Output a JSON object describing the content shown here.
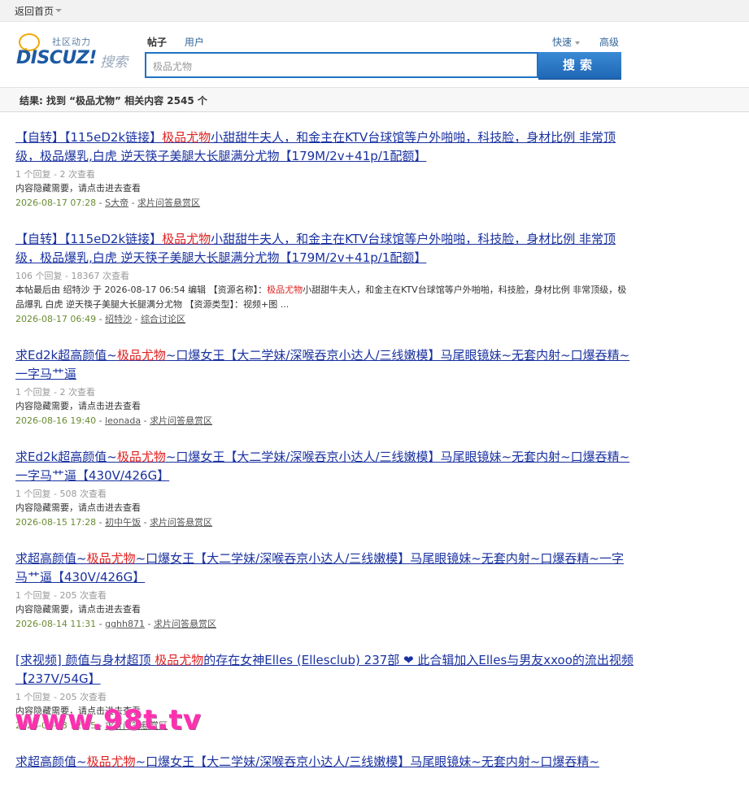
{
  "topbar": {
    "home_label": "返回首页"
  },
  "logo": {
    "slogan": "社区动力",
    "word": "DISCUZ!",
    "search_word": "搜索"
  },
  "tabs": [
    {
      "label": "帖子",
      "active": true
    },
    {
      "label": "用户",
      "active": false
    }
  ],
  "quick_label": "快速",
  "advanced_label": "高级",
  "search": {
    "value": "极品尤物",
    "button": "搜索"
  },
  "summary": "结果: 找到 “极品尤物” 相关内容 2545 个",
  "results": [
    {
      "title_pre": "【自转】【115eD2k链接】",
      "title_hl": "极品尤物",
      "title_post": "小甜甜牛夫人，和金主在KTV台球馆等户外啪啪，科技脸，身材比例 非常顶级，极品爆乳,白虎 逆天筷子美腿大长腿满分尤物【179M/2v+41p/1配额】",
      "stats": "1 个回复 - 2 次查看",
      "desc_pre": "内容隐藏需要，请点击进去查看",
      "desc_hl": "",
      "desc_post": "",
      "date": "2026-08-17 07:28",
      "author": "S大帝",
      "forum": "求片问答悬赏区"
    },
    {
      "title_pre": "【自转】【115eD2k链接】",
      "title_hl": "极品尤物",
      "title_post": "小甜甜牛夫人，和金主在KTV台球馆等户外啪啪，科技脸，身材比例 非常顶级，极品爆乳,白虎 逆天筷子美腿大长腿满分尤物【179M/2v+41p/1配额】",
      "stats": "106 个回复 - 18367 次查看",
      "desc_pre": "本帖最后由 绍特沙 于 2026-08-17 06:54 编辑 【资源名称】：",
      "desc_hl": "极品尤物",
      "desc_post": "小甜甜牛夫人，和金主在KTV台球馆等户外啪啪，科技脸，身材比例 非常顶级，极品爆乳 白虎 逆天筷子美腿大长腿满分尤物 【资源类型】：视频+图 ...",
      "date": "2026-08-17 06:49",
      "author": "绍特沙",
      "forum": "综合讨论区"
    },
    {
      "title_pre": "求Ed2k超高颜值~",
      "title_hl": "极品尤物",
      "title_post": "~口爆女王【大二学妹/深喉吞京小达人/三线嫩模】马尾眼镜妹~无套内射~口爆吞精~一字马艹逼",
      "stats": "1 个回复 - 2 次查看",
      "desc_pre": "内容隐藏需要，请点击进去查看",
      "desc_hl": "",
      "desc_post": "",
      "date": "2026-08-16 19:40",
      "author": "leonada",
      "forum": "求片问答悬赏区"
    },
    {
      "title_pre": "求Ed2k超高颜值~",
      "title_hl": "极品尤物",
      "title_post": "~口爆女王【大二学妹/深喉吞京小达人/三线嫩模】马尾眼镜妹~无套内射~口爆吞精~一字马艹逼【430V/426G】",
      "stats": "1 个回复 - 508 次查看",
      "desc_pre": "内容隐藏需要，请点击进去查看",
      "desc_hl": "",
      "desc_post": "",
      "date": "2026-08-15 17:28",
      "author": "初中午饭",
      "forum": "求片问答悬赏区"
    },
    {
      "title_pre": "求超高颜值~",
      "title_hl": "极品尤物",
      "title_post": "~口爆女王【大二学妹/深喉吞京小达人/三线嫩模】马尾眼镜妹~无套内射~口爆吞精~一字马艹逼【430V/426G】",
      "stats": "1 个回复 - 205 次查看",
      "desc_pre": "内容隐藏需要，请点击进去查看",
      "desc_hl": "",
      "desc_post": "",
      "date": "2026-08-14 11:31",
      "author": "gghh871",
      "forum": "求片问答悬赏区"
    },
    {
      "title_pre": "[求视频] 颜值与身材超顶 ",
      "title_hl": "极品尤物",
      "title_post": "的存在女神Elles (Ellesclub) 237部 ❤ 此合辑加入Elles与男友xxoo的流出视频【237V/54G】",
      "stats": "1 个回复 - 205 次查看",
      "desc_pre": "内容隐藏需要，请点击进去查看",
      "desc_hl": "",
      "desc_post": "",
      "date": "2026-08-13 12:45",
      "author": "",
      "forum": "求片问答悬赏区"
    },
    {
      "title_pre": "求超高颜值~",
      "title_hl": "极品尤物",
      "title_post": "~口爆女王【大二学妹/深喉吞京小达人/三线嫩模】马尾眼镜妹~无套内射~口爆吞精~",
      "stats": "",
      "desc_pre": "",
      "desc_hl": "",
      "desc_post": "",
      "date": "",
      "author": "",
      "forum": ""
    }
  ],
  "watermark": "www.98t.tv"
}
